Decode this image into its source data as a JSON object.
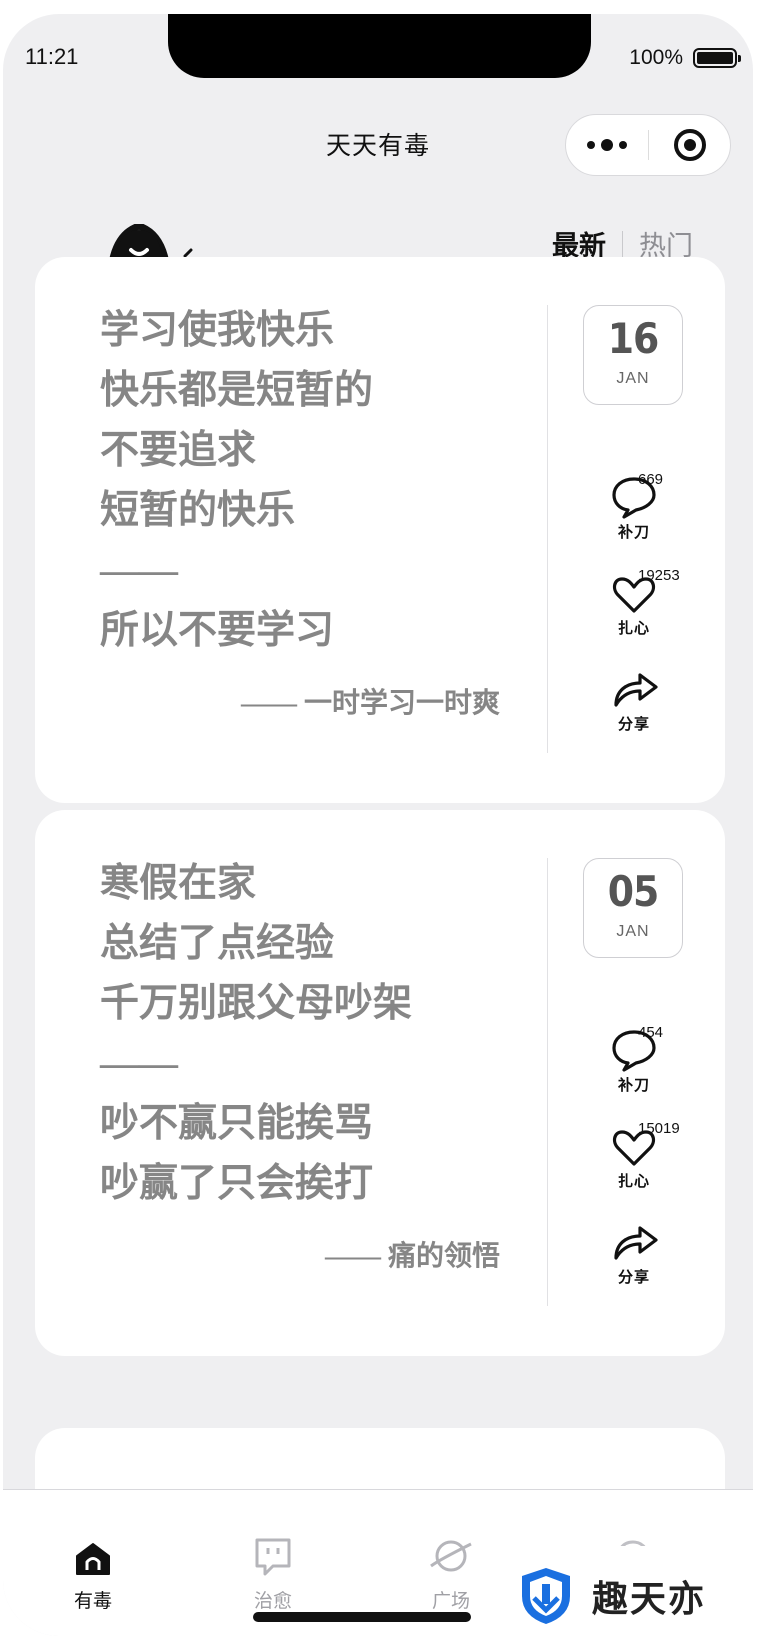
{
  "status_bar": {
    "time": "11:21",
    "battery": "100%"
  },
  "nav": {
    "title": "天天有毒"
  },
  "tabs": {
    "latest": "最新",
    "hot": "热门"
  },
  "cards": [
    {
      "lines": [
        "学习使我快乐",
        "快乐都是短暂的",
        "不要追求",
        "短暂的快乐",
        "——",
        "所以不要学习"
      ],
      "author": "—— 一时学习一时爽",
      "day": "16",
      "month": "JAN",
      "comment_count": "669",
      "comment_label": "补刀",
      "like_count": "19253",
      "like_label": "扎心",
      "share_label": "分享"
    },
    {
      "lines": [
        "寒假在家",
        "总结了点经验",
        "千万别跟父母吵架",
        "——",
        "吵不赢只能挨骂",
        "吵赢了只会挨打"
      ],
      "author": "—— 痛的领悟",
      "day": "05",
      "month": "JAN",
      "comment_count": "454",
      "comment_label": "补刀",
      "like_count": "15019",
      "like_label": "扎心",
      "share_label": "分享"
    }
  ],
  "tabbar": {
    "items": [
      {
        "label": "有毒",
        "icon": "home-icon",
        "active": true
      },
      {
        "label": "治愈",
        "icon": "chat-icon",
        "active": false
      },
      {
        "label": "广场",
        "icon": "planet-icon",
        "active": false
      },
      {
        "label": "",
        "icon": "profile-icon",
        "active": false
      }
    ]
  },
  "watermark": {
    "text": "趣天亦"
  },
  "colors": {
    "background": "#efeff1",
    "card": "#ffffff",
    "text_muted": "#868686",
    "active": "#111111",
    "inactive": "#a0a0a5",
    "brand_blue": "#1a6fe0"
  }
}
